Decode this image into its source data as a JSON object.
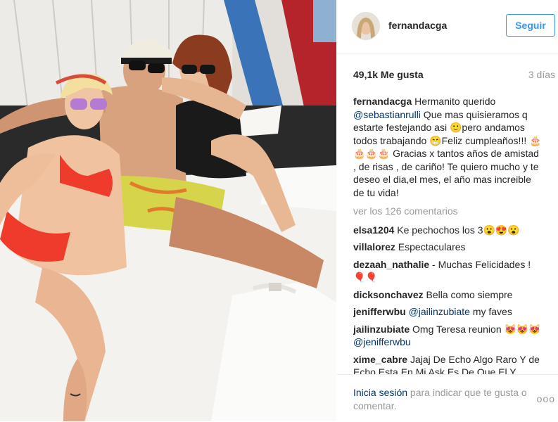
{
  "post": {
    "username": "fernandacga",
    "follow_label": "Seguir",
    "likes": "49,1k Me gusta",
    "time_ago": "3 días"
  },
  "caption": {
    "user": "fernandacga",
    "text_before": " Hermanito querido ",
    "mention": "@sebastianrulli",
    "text_after": " Que mas quisieramos q estarte festejando asi 🙂pero andamos todos trabajando 😁Feliz cumpleaños!!! 🎂🎂🎂🎂 Gracias x tantos años de amistad , de risas , de cariño! Te quiero mucho y te deseo el dia,el mes, el año mas increible de tu vida!"
  },
  "view_all": "ver los 126 comentarios",
  "comments": [
    {
      "user": "elsa1204",
      "text": " Ke pechochos los 3😮😍😮"
    },
    {
      "user": "villalorez",
      "text": " Espectaculares"
    },
    {
      "user": "dezaah_nathalie",
      "text": " - Muchas Felicidades ! 🎈🎈"
    },
    {
      "user": "dicksonchavez",
      "text": " Bella como siempre"
    },
    {
      "user": "jenifferwbu",
      "mention": "@jailinzubiate",
      "text": " my faves"
    },
    {
      "user": "jailinzubiate",
      "text": " Omg Teresa reunion 😻😻😻 ",
      "mention_after": "@jenifferwbu"
    },
    {
      "user": "xime_cabre",
      "text": " Jajaj De Echo Algo Raro Y de Echo Esta En Mi Ask Es De Que El Y"
    }
  ],
  "footer": {
    "login_link": "Inicia sesión",
    "login_text": " para indicar que te gusta o comentar.",
    "more": "ooo"
  }
}
